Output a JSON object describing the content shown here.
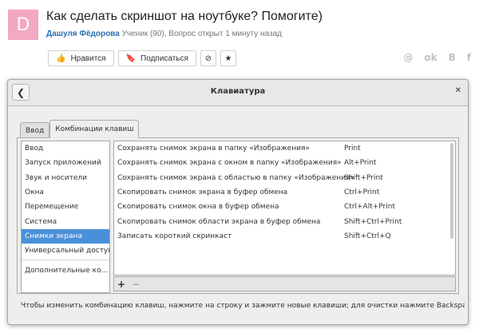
{
  "question": {
    "avatar_letter": "D",
    "title": "Как сделать скриншот на ноутбуке? Помогите)",
    "author": "Дашуля Фёдорова",
    "meta": "Ученик (90), Вопрос открыт 1 минуту назад",
    "like_label": "Нравится",
    "subscribe_label": "Подписаться",
    "share": [
      "@",
      "ok",
      "B",
      "f"
    ]
  },
  "dialog": {
    "title": "Клавиатура",
    "tabs": [
      {
        "label": "Ввод",
        "active": false
      },
      {
        "label": "Комбинации клавиш",
        "active": true
      }
    ],
    "sections": [
      "Ввод",
      "Запуск приложений",
      "Звук и носители",
      "Окна",
      "Перемещение",
      "Система",
      "Снимки экрана",
      "Универсальный доступ",
      "Дополнительные ко..."
    ],
    "selected_section": "Снимки экрана",
    "shortcuts": [
      {
        "action": "Сохранять снимок экрана в папку «Изображения»",
        "keys": "Print"
      },
      {
        "action": "Сохранять снимок экрана с окном в папку «Изображения»",
        "keys": "Alt+Print"
      },
      {
        "action": "Сохранять снимок экрана с областью в папку «Изображения»",
        "keys": "Shift+Print"
      },
      {
        "action": "Скопировать снимок экрана в буфер обмена",
        "keys": "Ctrl+Print"
      },
      {
        "action": "Скопировать снимок окна в буфер обмена",
        "keys": "Ctrl+Alt+Print"
      },
      {
        "action": "Скопировать снимок области экрана в буфер обмена",
        "keys": "Shift+Ctrl+Print"
      },
      {
        "action": "Записать короткий скринкаст",
        "keys": "Shift+Ctrl+Q"
      }
    ],
    "add_label": "+",
    "remove_label": "−",
    "hint": "Чтобы изменить комбинацию клавиш, нажмите на строку и зажмите новые клавиши; для очистки нажмите Backspace."
  },
  "colors": {
    "selection": "#4a90d9",
    "avatar": "#f4a7c2",
    "author_link": "#2a6fb0"
  }
}
